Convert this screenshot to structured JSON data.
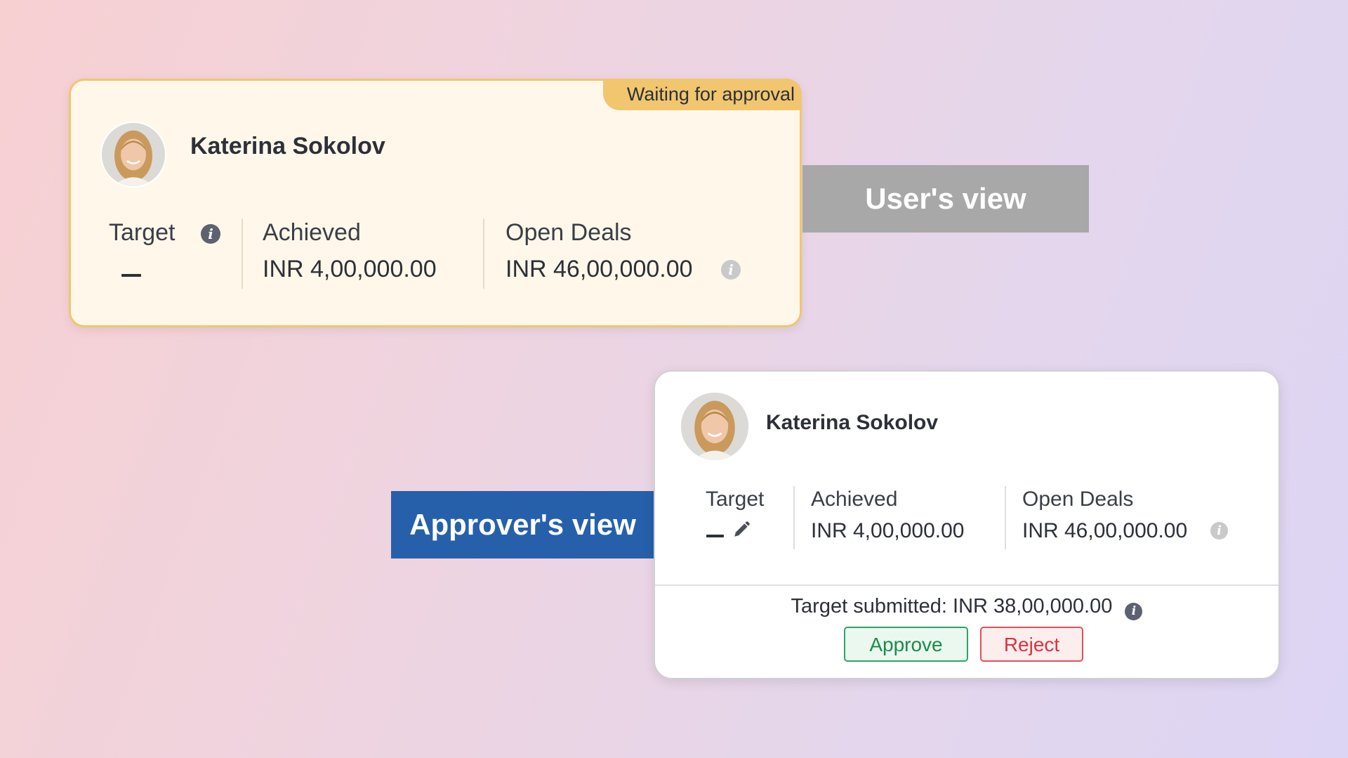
{
  "user_view": {
    "tag_label": "User's view",
    "status_badge": "Waiting for approval",
    "name": "Katerina Sokolov",
    "stats": {
      "target_label": "Target",
      "target_value": "—",
      "achieved_label": "Achieved",
      "achieved_value": "INR 4,00,000.00",
      "open_deals_label": "Open Deals",
      "open_deals_value": "INR 46,00,000.00"
    }
  },
  "approver_view": {
    "tag_label": "Approver's view",
    "name": "Katerina Sokolov",
    "stats": {
      "target_label": "Target",
      "target_value": "—",
      "achieved_label": "Achieved",
      "achieved_value": "INR 4,00,000.00",
      "open_deals_label": "Open Deals",
      "open_deals_value": "INR 46,00,000.00"
    },
    "target_submitted": "Target submitted: INR 38,00,000.00",
    "approve_label": "Approve",
    "reject_label": "Reject"
  },
  "icons": {
    "info": "info-icon",
    "edit": "pencil-icon",
    "avatar": "avatar"
  },
  "colors": {
    "pending_accent": "#f1c66f",
    "pending_card_bg": "#fff8ea",
    "user_tag_bg": "#a8a8a8",
    "approver_tag_bg": "#2660aa",
    "approve_green": "#31a363",
    "reject_red": "#e0505c"
  }
}
